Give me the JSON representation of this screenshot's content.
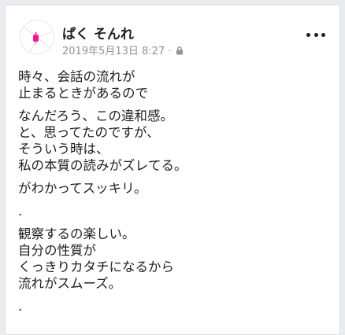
{
  "post": {
    "author": "ぱく そんれ",
    "date": "2019年5月13日 8:27 ·",
    "privacy_icon": "lock-icon",
    "more_icon": "more-options-icon",
    "paragraphs": [
      [
        "時々、会話の流れが",
        "止まるときがあるので"
      ],
      [
        "なんだろう、この違和感。",
        "と、思ってたのですが、",
        "そういう時は、",
        "私の本質の読みがズレてる。"
      ],
      [
        "がわかってスッキリ。"
      ],
      [
        "."
      ],
      [
        "観察するの楽しい。",
        "自分の性質が",
        "くっきりカタチになるから",
        "流れがスムーズ。"
      ],
      [
        "."
      ]
    ]
  },
  "colors": {
    "background": "#e9ebee",
    "card": "#ffffff",
    "text": "#1c1e21",
    "meta": "#90949c",
    "avatar_accent": "#e91e8c"
  }
}
